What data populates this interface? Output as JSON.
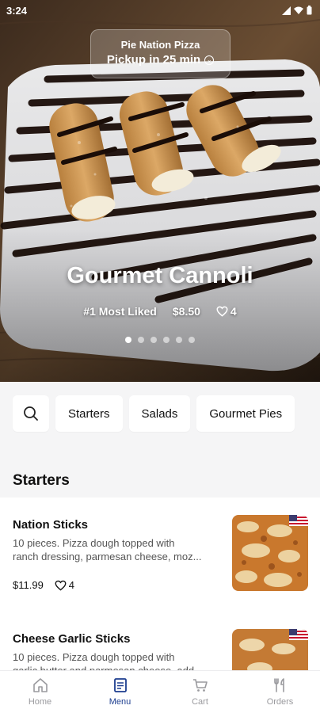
{
  "status": {
    "time": "3:24"
  },
  "store": {
    "name": "Pie Nation Pizza",
    "pickup": "Pickup in 25 min"
  },
  "featured": {
    "title": "Gourmet Cannoli",
    "badge": "#1 Most Liked",
    "price": "$8.50",
    "likes": "4",
    "carousel_count": 6,
    "carousel_active": 1
  },
  "categories": [
    {
      "label": "Starters"
    },
    {
      "label": "Salads"
    },
    {
      "label": "Gourmet Pies"
    }
  ],
  "section": {
    "title": "Starters"
  },
  "items": [
    {
      "name": "Nation Sticks",
      "desc_line1": "10 pieces. Pizza dough topped with",
      "desc_line2": "ranch dressing, parmesan cheese, moz...",
      "price": "$11.99",
      "likes": "4"
    },
    {
      "name": "Cheese Garlic Sticks",
      "desc_line1": "10 pieces. Pizza dough topped with",
      "desc_line2": "garlic butter and parmesan cheese, add..."
    }
  ],
  "nav": [
    {
      "label": "Home",
      "icon": "home-icon"
    },
    {
      "label": "Menu",
      "icon": "menu-icon",
      "active": true
    },
    {
      "label": "Cart",
      "icon": "cart-icon"
    },
    {
      "label": "Orders",
      "icon": "orders-icon"
    }
  ],
  "colors": {
    "accent": "#1c3d8f",
    "inactive": "#9a9a9e",
    "background": "#f5f5f6"
  }
}
